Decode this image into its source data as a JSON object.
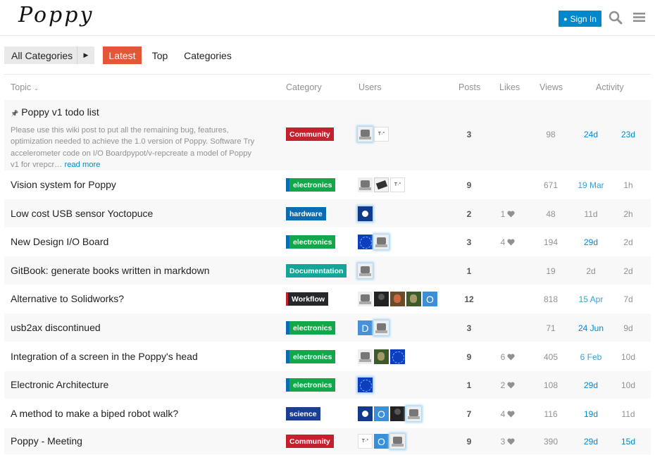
{
  "header": {
    "logo": "Poppy",
    "signin_label": "Sign In"
  },
  "nav": {
    "category_dropdown": "All Categories",
    "tabs": [
      "Latest",
      "Top",
      "Categories"
    ]
  },
  "table": {
    "columns": {
      "topic": "Topic",
      "category": "Category",
      "users": "Users",
      "posts": "Posts",
      "likes": "Likes",
      "views": "Views",
      "activity": "Activity"
    },
    "rows": [
      {
        "title": "Poppy v1 todo list",
        "pinned": true,
        "excerpt": "Please use this wiki post to put all the remaining bug, features, optimization needed to achieve the 1.0 version of Poppy. Software Try accelerometer code on I/O Boardpypot/v-repcreate a model of Poppy v1 for vrepcr…",
        "read_more": "read more",
        "category": "Community",
        "category_color": "#c4202d",
        "avatars": [
          "robot",
          "sketch"
        ],
        "posts": "3",
        "likes": "",
        "views": "98",
        "created": "24d",
        "last": "23d"
      },
      {
        "title": "Vision system for Poppy",
        "category": "electronics",
        "category_color": "#12a84a",
        "avatars": [
          "robot",
          "cam",
          "sketch"
        ],
        "posts": "9",
        "likes": "",
        "views": "671",
        "created": "19 Mar",
        "last": "1h"
      },
      {
        "title": "Low cost USB sensor Yoctopuce",
        "category": "hardware",
        "category_color": "#0a6db4",
        "avatars": [
          "hw"
        ],
        "posts": "2",
        "likes": "1",
        "views": "48",
        "created": "11d",
        "last": "2h"
      },
      {
        "title": "New Design I/O Board",
        "category": "electronics",
        "category_color": "#12a84a",
        "avatars": [
          "blue",
          "robot"
        ],
        "posts": "3",
        "likes": "4",
        "views": "194",
        "created": "29d",
        "last": "2d"
      },
      {
        "title": "GitBook: generate books written in markdown",
        "category": "Documentation",
        "category_color": "#12a598",
        "avatars": [
          "robot"
        ],
        "posts": "1",
        "likes": "",
        "views": "19",
        "created": "2d",
        "last": "2d"
      },
      {
        "title": "Alternative to Solidworks?",
        "category": "Workflow",
        "category_color": "#25272b",
        "avatars": [
          "robot",
          "dark",
          "photo",
          "photo2",
          "letter-o"
        ],
        "letters": [
          "",
          "",
          "",
          "",
          "O"
        ],
        "posts": "12",
        "likes": "",
        "views": "818",
        "created": "15 Apr",
        "last": "7d"
      },
      {
        "title": "usb2ax discontinued",
        "category": "electronics",
        "category_color": "#12a84a",
        "avatars": [
          "letter",
          "robot"
        ],
        "letters": [
          "D",
          ""
        ],
        "posts": "3",
        "likes": "",
        "views": "71",
        "created": "24 Jun",
        "last": "9d"
      },
      {
        "title": "Integration of a screen in the Poppy's head",
        "category": "electronics",
        "category_color": "#12a84a",
        "avatars": [
          "robot",
          "photo2",
          "blue"
        ],
        "posts": "9",
        "likes": "6",
        "views": "405",
        "created": "6 Feb",
        "last": "10d"
      },
      {
        "title": "Electronic Architecture",
        "category": "electronics",
        "category_color": "#12a84a",
        "avatars": [
          "blue"
        ],
        "posts": "1",
        "likes": "2",
        "views": "108",
        "created": "29d",
        "last": "10d"
      },
      {
        "title": "A method to make a biped robot walk?",
        "category": "science",
        "category_color": "#1a3e94",
        "avatars": [
          "hw",
          "letter-o",
          "dark",
          "robot"
        ],
        "letters": [
          "",
          "O",
          "",
          ""
        ],
        "posts": "7",
        "likes": "4",
        "views": "116",
        "created": "19d",
        "last": "11d"
      },
      {
        "title": "Poppy - Meeting",
        "category": "Community",
        "category_color": "#c4202d",
        "avatars": [
          "sketch",
          "letter-o",
          "robot"
        ],
        "letters": [
          "",
          "O",
          ""
        ],
        "posts": "9",
        "likes": "3",
        "views": "390",
        "created": "29d",
        "last": "15d"
      }
    ]
  },
  "colors": {
    "accent": "#e45735",
    "link": "#0088cc"
  }
}
